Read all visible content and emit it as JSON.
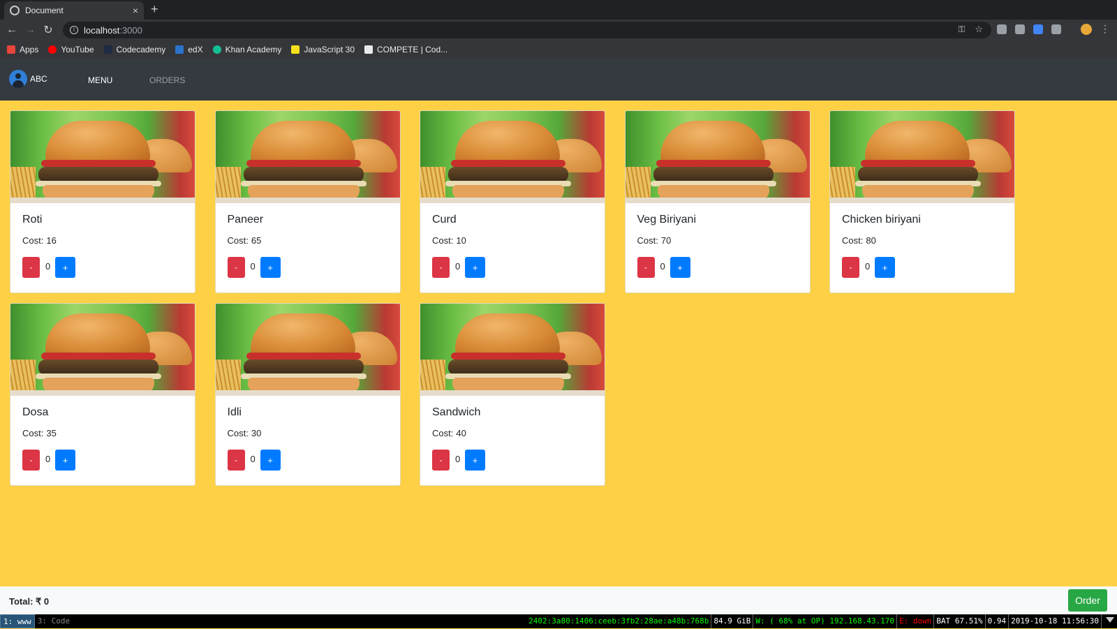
{
  "browser": {
    "tab_title": "Document",
    "tab_close": "×",
    "new_tab": "+",
    "url_host": "localhost",
    "url_port": ":3000",
    "bookmarks": [
      {
        "label": "Apps",
        "color": "#e8453c"
      },
      {
        "label": "YouTube",
        "color": "#ff0000"
      },
      {
        "label": "Codecademy",
        "color": "#1f2a44"
      },
      {
        "label": "edX",
        "color": "#2a73cc"
      },
      {
        "label": "Khan Academy",
        "color": "#14bf96"
      },
      {
        "label": "JavaScript 30",
        "color": "#f7df1e"
      },
      {
        "label": "COMPETE | Cod...",
        "color": "#e8eaed"
      }
    ]
  },
  "nav": {
    "brand": "ABC",
    "menu": "MENU",
    "orders": "ORDERS"
  },
  "menu_items": [
    {
      "name": "Roti",
      "cost_label": "Cost:",
      "cost": "16",
      "qty": "0"
    },
    {
      "name": "Paneer",
      "cost_label": "Cost:",
      "cost": "65",
      "qty": "0"
    },
    {
      "name": "Curd",
      "cost_label": "Cost:",
      "cost": "10",
      "qty": "0"
    },
    {
      "name": "Veg Biriyani",
      "cost_label": "Cost:",
      "cost": "70",
      "qty": "0"
    },
    {
      "name": "Chicken biriyani",
      "cost_label": "Cost:",
      "cost": "80",
      "qty": "0"
    },
    {
      "name": "Dosa",
      "cost_label": "Cost:",
      "cost": "35",
      "qty": "0"
    },
    {
      "name": "Idli",
      "cost_label": "Cost:",
      "cost": "30",
      "qty": "0"
    },
    {
      "name": "Sandwich",
      "cost_label": "Cost:",
      "cost": "40",
      "qty": "0"
    }
  ],
  "buttons": {
    "minus": "-",
    "plus": "+"
  },
  "footer": {
    "total": "Total: ₹ 0",
    "order": "Order"
  },
  "statusbar": {
    "ws1": "1: www",
    "ws3": "3: Code",
    "ipv6": "2402:3a80:1406:ceeb:3fb2:28ae:a48b:768b",
    "disk": "84.9 GiB",
    "wifi": "W: ( 68% at OP) 192.168.43.170",
    "eth": "E: down",
    "battery": "BAT 67.51%",
    "load": "0.94",
    "datetime": "2019-10-18 11:56:30"
  },
  "colors": {
    "page_bg": "#fed045",
    "navbar": "#343a40",
    "minus_btn": "#dc3545",
    "plus_btn": "#007bff",
    "order_btn": "#28a745"
  }
}
